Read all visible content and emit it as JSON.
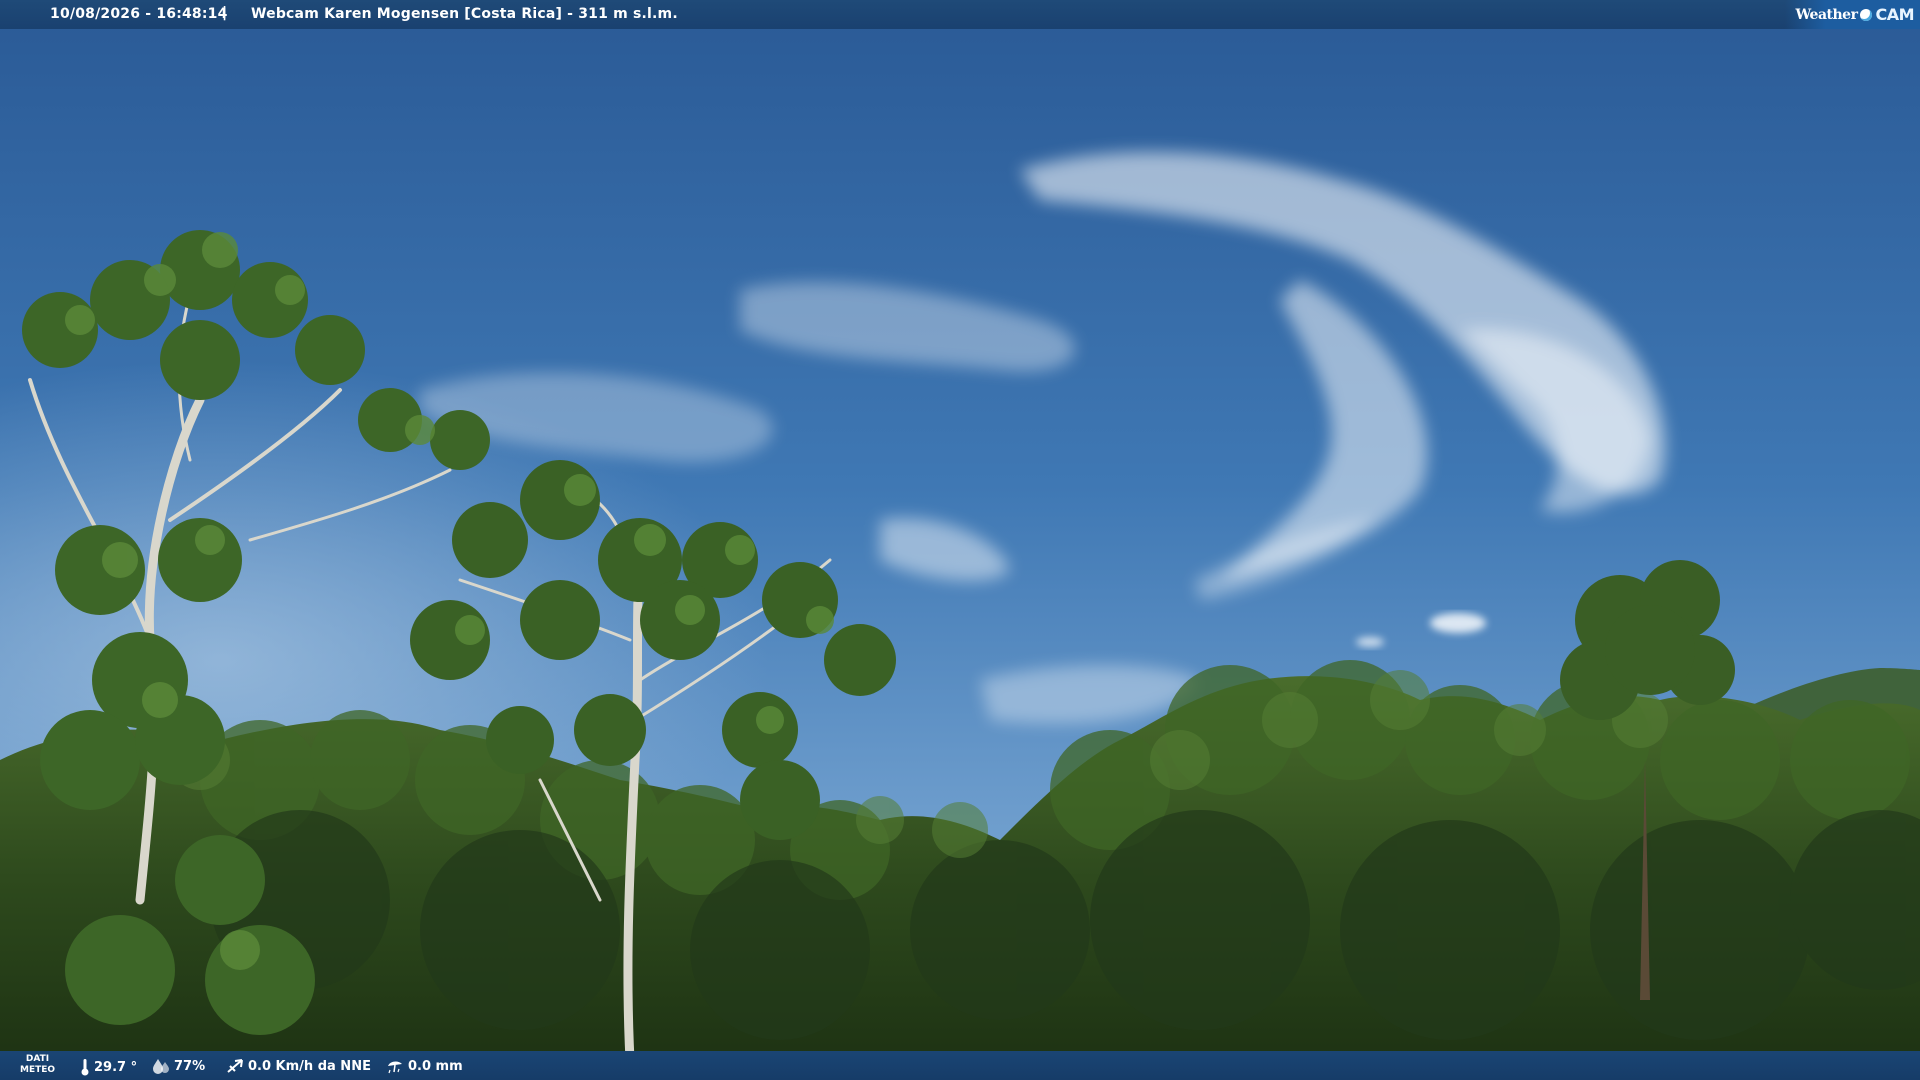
{
  "header": {
    "timestamp": "10/08/2026 - 16:48:14",
    "separator": "|",
    "title": "Webcam Karen Mogensen [Costa Rica]  - 311 m s.l.m."
  },
  "logo": {
    "weather_text": "Weather",
    "cam_text": "CAM"
  },
  "footer": {
    "dati_line1": "DATI",
    "dati_line2": "METEO",
    "temperature": "29.7 °",
    "humidity": "77%",
    "wind": "0.0 Km/h da NNE",
    "rain": "0.0 mm"
  },
  "scene": {
    "description_icon": "landscape-photo",
    "sky_color": "#3c77b6",
    "foliage_color": "#2c4a1c"
  }
}
